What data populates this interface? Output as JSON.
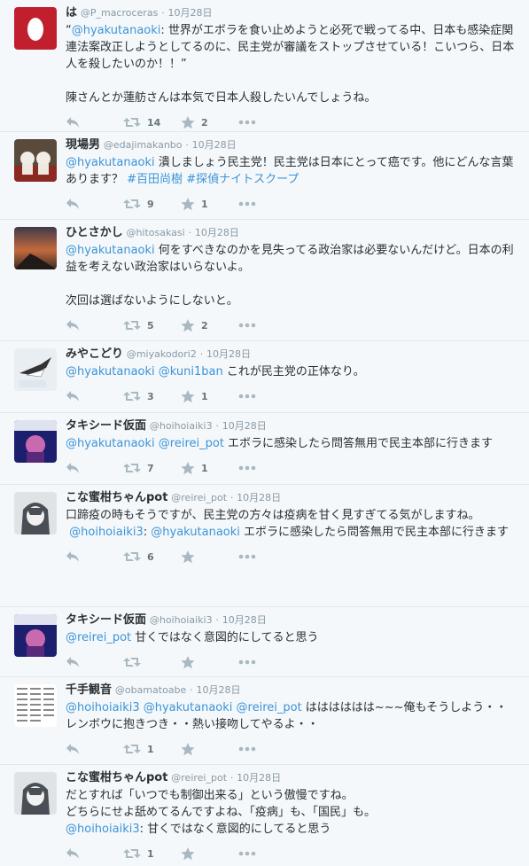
{
  "tweets": [
    {
      "name": "は",
      "handle": "@P_macroceras",
      "date": "10月28日",
      "segments": [
        {
          "t": "“",
          "link": false
        },
        {
          "t": "@hyakutanaoki",
          "link": true
        },
        {
          "t": ": 世界がエボラを食い止めようと必死で戦ってる中、日本も感染症関連法案改正しようとしてるのに、民主党が審議をストップさせている！こいつら、日本人を殺したいのか！！”\n\n陳さんとか蓮舫さんは本気で日本人殺したいんでしょうね。",
          "link": false
        }
      ],
      "retweets": "14",
      "favorites": "2"
    },
    {
      "name": "現場男",
      "handle": "@edajimakanbo",
      "date": "10月28日",
      "segments": [
        {
          "t": "@hyakutanaoki",
          "link": true
        },
        {
          "t": " 潰しましょう民主党！民主党は日本にとって癌です。他にどんな言葉あります？ ",
          "link": false
        },
        {
          "t": "#百田尚樹",
          "link": true
        },
        {
          "t": " ",
          "link": false
        },
        {
          "t": "#探偵ナイトスクープ",
          "link": true
        }
      ],
      "retweets": "9",
      "favorites": "1"
    },
    {
      "name": "ひとさかし",
      "handle": "@hitosakasi",
      "date": "10月28日",
      "segments": [
        {
          "t": "@hyakutanaoki",
          "link": true
        },
        {
          "t": " 何をすべきなのかを見失ってる政治家は必要ないんだけど。日本の利益を考えない政治家はいらないよ。\n\n次回は選ばないようにしないと。",
          "link": false
        }
      ],
      "retweets": "5",
      "favorites": "2"
    },
    {
      "name": "みやこどり",
      "handle": "@miyakodori2",
      "date": "10月28日",
      "segments": [
        {
          "t": "@hyakutanaoki",
          "link": true
        },
        {
          "t": " ",
          "link": false
        },
        {
          "t": "@kuni1ban",
          "link": true
        },
        {
          "t": " これが民主党の正体なり。",
          "link": false
        }
      ],
      "retweets": "3",
      "favorites": "1"
    },
    {
      "name": "タキシード仮面",
      "handle": "@hoihoiaiki3",
      "date": "10月28日",
      "segments": [
        {
          "t": "@hyakutanaoki",
          "link": true
        },
        {
          "t": " ",
          "link": false
        },
        {
          "t": "@reirei_pot",
          "link": true
        },
        {
          "t": " エボラに感染したら問答無用で民主本部に行きます",
          "link": false
        }
      ],
      "retweets": "7",
      "favorites": "1"
    },
    {
      "name": "こな蜜柑ちゃんpot",
      "handle": "@reirei_pot",
      "date": "10月28日",
      "segments": [
        {
          "t": "口蹄疫の時もそうですが、民主党の方々は疫病を甘く見すぎてる気がしますね。\n ",
          "link": false
        },
        {
          "t": "@hoihoiaiki3",
          "link": true
        },
        {
          "t": ": ",
          "link": false
        },
        {
          "t": "@hyakutanaoki",
          "link": true
        },
        {
          "t": " エボラに感染したら問答無用で民主本部に行きます",
          "link": false
        }
      ],
      "retweets": "6",
      "favorites": ""
    },
    {
      "name": "タキシード仮面",
      "handle": "@hoihoiaiki3",
      "date": "10月28日",
      "segments": [
        {
          "t": "@reirei_pot",
          "link": true
        },
        {
          "t": " 甘くではなく意図的にしてると思う",
          "link": false
        }
      ],
      "retweets": "",
      "favorites": ""
    },
    {
      "name": "千手観音",
      "handle": "@obamatoabe",
      "date": "10月28日",
      "segments": [
        {
          "t": "@hoihoiaiki3",
          "link": true
        },
        {
          "t": " ",
          "link": false
        },
        {
          "t": "@hyakutanaoki",
          "link": true
        },
        {
          "t": " ",
          "link": false
        },
        {
          "t": "@reirei_pot",
          "link": true
        },
        {
          "t": " はははははは~~~俺もそうしよう・・レンボウに抱きつき・・熱い接吻してやるよ・・",
          "link": false
        }
      ],
      "retweets": "1",
      "favorites": ""
    },
    {
      "name": "こな蜜柑ちゃんpot",
      "handle": "@reirei_pot",
      "date": "10月28日",
      "segments": [
        {
          "t": "だとすれば「いつでも制御出来る」という傲慢ですね。\nどちらにせよ舐めてるんですよね、「疫病」も、「国民」も。\n",
          "link": false
        },
        {
          "t": "@hoihoiaiki3",
          "link": true
        },
        {
          "t": ": 甘くではなく意図的にしてると思う",
          "link": false
        }
      ],
      "retweets": "1",
      "favorites": ""
    }
  ],
  "icons": {
    "reply": "reply-icon",
    "retweet": "retweet-icon",
    "favorite": "star-icon",
    "more": "more-icon"
  },
  "colors": {
    "background": "#f5f8fa",
    "link": "#3b94d9",
    "meta": "#8899a6",
    "icon": "#aab8c2"
  }
}
